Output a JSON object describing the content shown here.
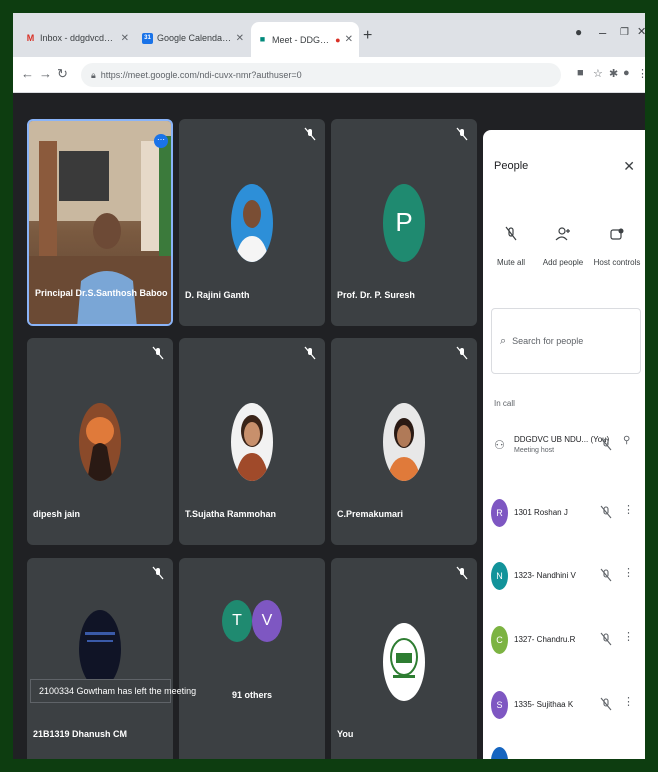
{
  "browser": {
    "tabs": [
      {
        "title": "Inbox - ddgdvcdecfedcd@gmail",
        "favicon": "M",
        "favicon_color": "#d93025"
      },
      {
        "title": "Google Calendar - Week of Nov",
        "favicon": "31",
        "favicon_color": "#1a73e8"
      },
      {
        "title": "Meet - DDGDVC NDU CUVI",
        "favicon": "■",
        "favicon_color": "#00897b"
      }
    ],
    "new_tab": "+",
    "address": "https://meet.google.com/ndi-cuvx-nmr?authuser=0"
  },
  "tiles": [
    {
      "name": "Principal Dr.S.Santhosh Baboo",
      "type": "video"
    },
    {
      "name": "D. Rajini Ganth",
      "type": "photo",
      "bg": "#2d8fd8"
    },
    {
      "name": "Prof. Dr. P. Suresh",
      "type": "initial",
      "initial": "P",
      "bg": "#1f8a70"
    },
    {
      "name": "dipesh jain",
      "type": "photo",
      "bg": "#8a4a2a"
    },
    {
      "name": "T.Sujatha Rammohan",
      "type": "photo",
      "bg": "#f2f2f2"
    },
    {
      "name": "C.Premakumari",
      "type": "photo",
      "bg": "#e8e8e8"
    },
    {
      "name": "21B1319 Dhanush CM",
      "type": "photo",
      "bg": "#101426"
    },
    {
      "name": "91 others",
      "type": "others",
      "initials": [
        "T",
        "V"
      ],
      "colors": [
        "#1f8a70",
        "#7e57c2"
      ]
    },
    {
      "name": "You",
      "type": "logo",
      "bg": "#ffffff"
    }
  ],
  "toast": "2100334 Gowtham has left the meeting",
  "people": {
    "title": "People",
    "actions": [
      {
        "label": "Mute all",
        "icon": "mic-off-icon"
      },
      {
        "label": "Add people",
        "icon": "person-add-icon"
      },
      {
        "label": "Host controls",
        "icon": "host-controls-icon"
      }
    ],
    "search_placeholder": "Search for people",
    "section": "In call",
    "host": {
      "name": "DDGDVC UB NDU...",
      "tag": "(You)",
      "role": "Meeting host"
    },
    "participants": [
      {
        "initial": "R",
        "name": "1301 Roshan J",
        "color": "#7e57c2"
      },
      {
        "initial": "N",
        "name": "1323- Nandhini V",
        "color": "#12939a"
      },
      {
        "initial": "C",
        "name": "1327- Chandru.R",
        "color": "#7cb342"
      },
      {
        "initial": "S",
        "name": "1335- Sujithaa K",
        "color": "#7e57c2"
      }
    ]
  }
}
